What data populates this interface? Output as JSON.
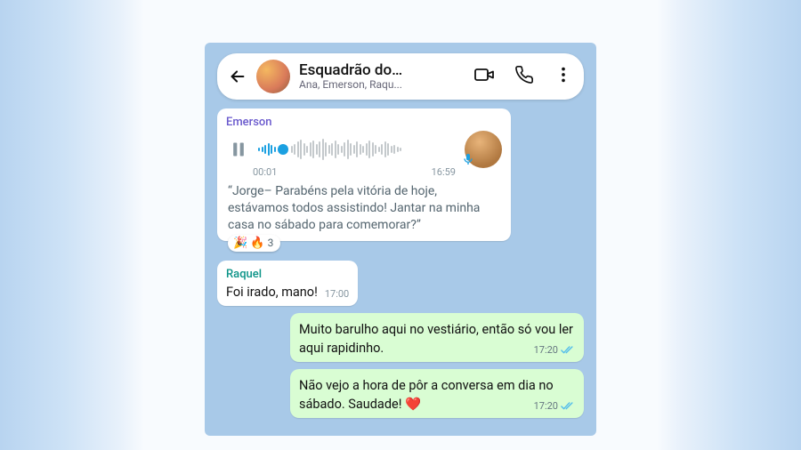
{
  "header": {
    "title": "Esquadrão do…",
    "subtitle": "Ana, Emerson, Raqu..."
  },
  "voice": {
    "sender": "Emerson",
    "elapsed": "00:01",
    "duration": "16:59",
    "transcript": "“Jorge– Parabéns pela vitória de hoje, estávamos todos assistindo! Jantar na minha casa no sábado para comemorar?”",
    "reactions": {
      "emojis": "🎉 🔥",
      "count": "3"
    }
  },
  "msg_raquel": {
    "sender": "Raquel",
    "text": "Foi irado, mano!",
    "time": "17:00"
  },
  "out1": {
    "text": "Muito barulho aqui no vestiário, então só vou ler aqui rapidinho.",
    "time": "17:20"
  },
  "out2": {
    "text": "Não vejo a hora de pôr a conversa em dia no sábado. Saudade! ❤️",
    "time": "17:20"
  }
}
